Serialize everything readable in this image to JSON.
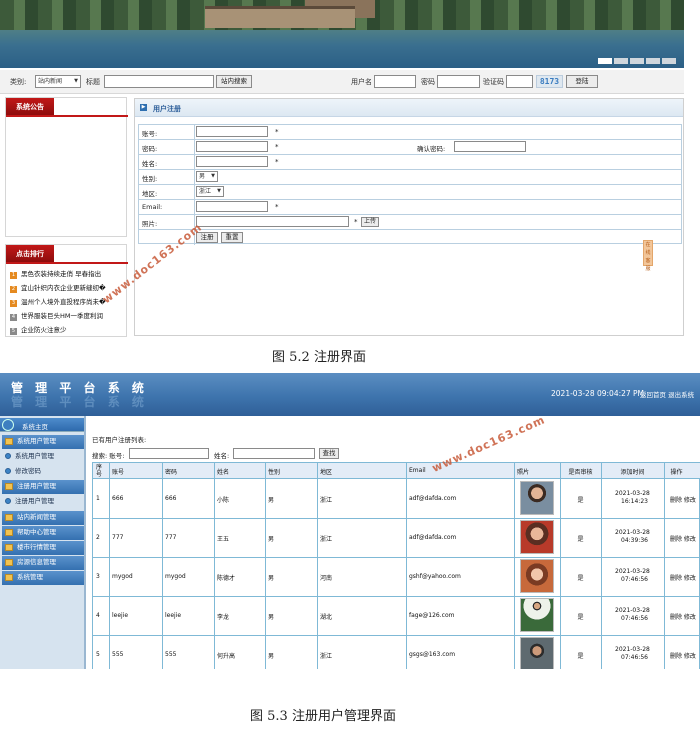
{
  "figure1": {
    "searchbar": {
      "category_label": "类别:",
      "category_value": "站内新闻",
      "title_label": "标题",
      "search_button": "站内搜索",
      "username_label": "用户名",
      "password_label": "密码",
      "captcha_label": "验证码",
      "captcha_value": "8173",
      "login_button": "登陆"
    },
    "notice": {
      "title": "系统公告"
    },
    "ranking": {
      "title": "点击排行",
      "items": [
        {
          "num": "1",
          "text": "黑色衣装持续走俏 早春指出"
        },
        {
          "num": "2",
          "text": "宜山针织内衣企业更新缝纫�"
        },
        {
          "num": "3",
          "text": "温州个人境外直投程序尚未�"
        },
        {
          "num": "4",
          "text": "世界服装巨头HM一季度利润"
        },
        {
          "num": "5",
          "text": "企业防火注意少"
        }
      ]
    },
    "register": {
      "title": "用户注册",
      "account_label": "账号:",
      "password_label": "密码:",
      "confirm_label": "确认密码:",
      "name_label": "姓名:",
      "gender_label": "性别:",
      "gender_value": "男",
      "region_label": "地区:",
      "region_value": "浙江",
      "email_label": "Email:",
      "photo_label": "照片:",
      "upload_button": "上传",
      "register_button": "注册",
      "reset_button": "重置",
      "star": "*"
    },
    "side_badge": "在线客服",
    "watermark": "www.doc163.com",
    "caption": "图 5.2 注册界面"
  },
  "figure2": {
    "header": {
      "title": "管 理 平 台 系 统",
      "datetime": "2021-03-28 09:04:27 PM",
      "links": "返回首页 退出系统"
    },
    "nav": {
      "home": "系统主页",
      "items": [
        {
          "label": "系统用户管理",
          "type": "main"
        },
        {
          "label": "系统用户管理",
          "type": "sub"
        },
        {
          "label": "修改密码",
          "type": "sub"
        },
        {
          "label": "注册用户管理",
          "type": "main"
        },
        {
          "label": "注册用户管理",
          "type": "sub"
        },
        {
          "label": "站内新闻管理",
          "type": "main"
        },
        {
          "label": "帮助中心管理",
          "type": "main"
        },
        {
          "label": "楼市行情管理",
          "type": "main"
        },
        {
          "label": "房源信息管理",
          "type": "main"
        },
        {
          "label": "系统管理",
          "type": "main"
        }
      ]
    },
    "list_title": "已有用户注册列表:",
    "search": {
      "label": "搜索: 账号:",
      "name_label": "姓名:",
      "button": "查找"
    },
    "columns": [
      "序号",
      "账号",
      "密码",
      "姓名",
      "性别",
      "地区",
      "Email",
      "照片",
      "是否审核",
      "添加时间",
      "操作"
    ],
    "rows": [
      {
        "no": "1",
        "account": "666",
        "password": "666",
        "name": "小陈",
        "gender": "男",
        "region": "浙江",
        "email": "adf@dafda.com",
        "approved": "是",
        "date": "2021-03-28",
        "time": "16:14:23",
        "ops": "删除 修改"
      },
      {
        "no": "2",
        "account": "777",
        "password": "777",
        "name": "王五",
        "gender": "男",
        "region": "浙江",
        "email": "adf@dafda.com",
        "approved": "是",
        "date": "2021-03-28",
        "time": "04:39:36",
        "ops": "删除 修改"
      },
      {
        "no": "3",
        "account": "mygod",
        "password": "mygod",
        "name": "陈德才",
        "gender": "男",
        "region": "河南",
        "email": "gshf@yahoo.com",
        "approved": "是",
        "date": "2021-03-28",
        "time": "07:46:56",
        "ops": "删除 修改"
      },
      {
        "no": "4",
        "account": "leejie",
        "password": "leejie",
        "name": "李龙",
        "gender": "男",
        "region": "湖北",
        "email": "fage@126.com",
        "approved": "是",
        "date": "2021-03-28",
        "time": "07:46:56",
        "ops": "删除 修改"
      },
      {
        "no": "5",
        "account": "555",
        "password": "555",
        "name": "何升高",
        "gender": "男",
        "region": "浙江",
        "email": "gsgs@163.com",
        "approved": "是",
        "date": "2021-03-28",
        "time": "07:46:56",
        "ops": "删除 修改"
      }
    ],
    "watermark": "www.doc163.com",
    "caption": "图 5.3 注册用户管理界面"
  }
}
